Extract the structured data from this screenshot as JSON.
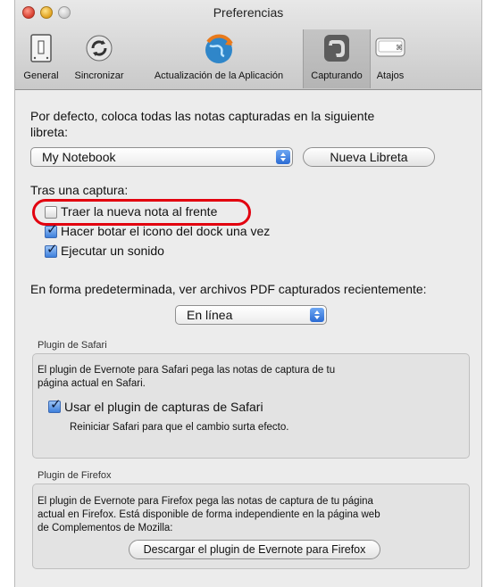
{
  "window": {
    "title": "Preferencias"
  },
  "toolbar": {
    "items": [
      {
        "label": "General",
        "icon": "switch-icon"
      },
      {
        "label": "Sincronizar",
        "icon": "sync-icon"
      },
      {
        "label": "Actualización de la Aplicación",
        "icon": "globe-update-icon"
      },
      {
        "label": "Capturando",
        "icon": "elephant-icon",
        "selected": true
      },
      {
        "label": "Atajos",
        "icon": "keyboard-key-icon"
      }
    ]
  },
  "capture": {
    "notebook_prompt_line1": "Por defecto, coloca todas las notas capturadas en la siguiente",
    "notebook_prompt_line2": "libreta:",
    "notebook_value": "My Notebook",
    "new_notebook_button": "Nueva Libreta",
    "after_capture_label": "Tras una captura:",
    "options": [
      {
        "label": "Traer la nueva nota al frente",
        "checked": false
      },
      {
        "label": "Hacer botar el icono del dock una vez",
        "checked": true
      },
      {
        "label": "Ejecutar un sonido",
        "checked": true
      }
    ],
    "pdf_label": "En forma predeterminada, ver archivos PDF capturados recientemente:",
    "pdf_value": "En línea"
  },
  "safari": {
    "group_label": "Plugin de Safari",
    "desc_line1": "El plugin de Evernote para Safari pega las notas de captura de tu",
    "desc_line2": "página actual en Safari.",
    "checkbox_label": "Usar el plugin de capturas de Safari",
    "checkbox_checked": true,
    "note": "Reiniciar Safari para que el cambio surta efecto."
  },
  "firefox": {
    "group_label": "Plugin de Firefox",
    "desc_line1": "El plugin de Evernote para Firefox pega las notas de captura de tu página",
    "desc_line2": "actual en Firefox. Está disponible de forma independiente en la página web",
    "desc_line3": "de Complementos de Mozilla:",
    "download_button": "Descargar el plugin de Evernote para Firefox"
  },
  "colors": {
    "highlight": "#e2000f",
    "accent": "#3d7fdc"
  }
}
